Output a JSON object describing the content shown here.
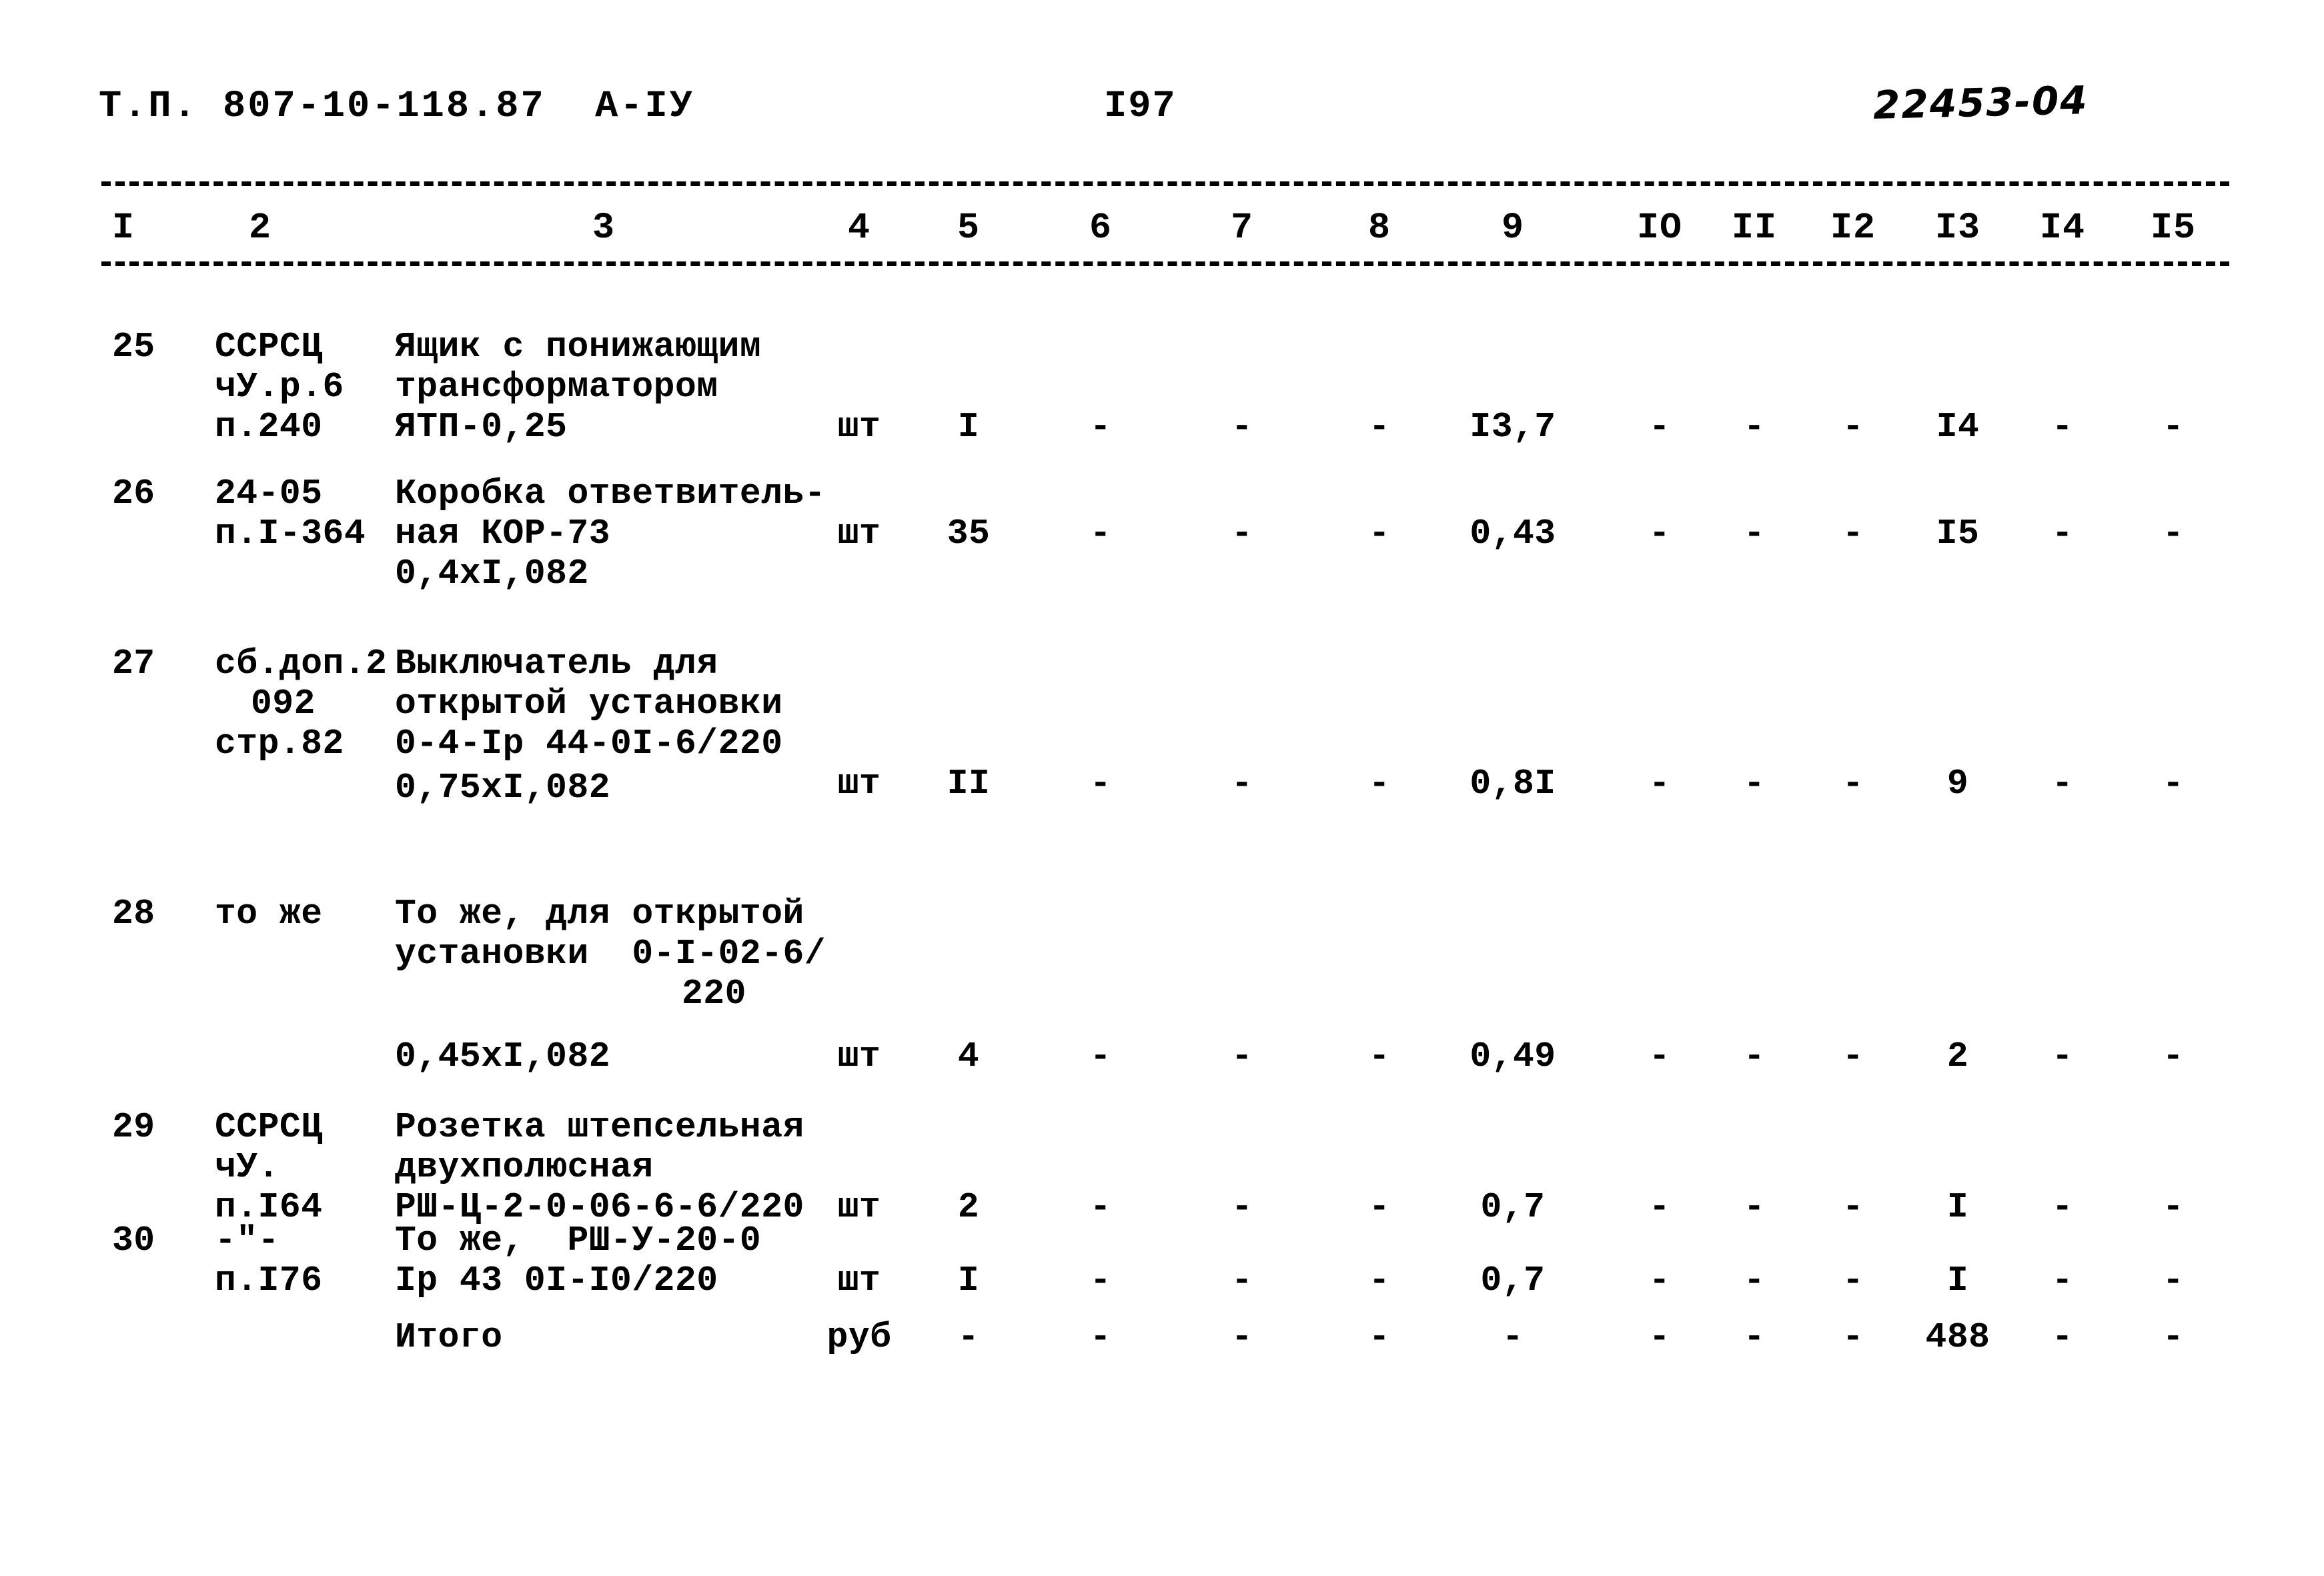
{
  "header": {
    "doc_code": "Т.П. 807-10-118.87  А-IУ",
    "page_number": "I97",
    "archive_code": "22453-04"
  },
  "table": {
    "column_numbers": [
      "I",
      "2",
      "3",
      "4",
      "5",
      "6",
      "7",
      "8",
      "9",
      "IO",
      "II",
      "I2",
      "I3",
      "I4",
      "I5"
    ],
    "rows": [
      {
        "no": "25",
        "code_lines": [
          "ССРСЦ",
          "чУ.р.6",
          "п.240"
        ],
        "name_lines": [
          "Ящик с понижающим",
          "трансформатором",
          "ЯТП-0,25"
        ],
        "unit": "шт",
        "values": [
          "I",
          "-",
          "-",
          "-",
          "I3,7",
          "-",
          "-",
          "-",
          "I4",
          "-",
          "-"
        ]
      },
      {
        "no": "26",
        "code_lines": [
          "24-05",
          "п.I-364"
        ],
        "name_lines": [
          "Коробка ответвитель-",
          "ная КОР-73",
          "0,4хI,082"
        ],
        "unit": "шт",
        "values": [
          "35",
          "-",
          "-",
          "-",
          "0,43",
          "-",
          "-",
          "-",
          "I5",
          "-",
          "-"
        ]
      },
      {
        "no": "27",
        "code_lines": [
          "сб.доп.2",
          "092",
          "стр.82"
        ],
        "name_lines": [
          "Выключатель для",
          "открытой установки",
          "0-4-Iр 44-0I-6/220",
          "0,75хI,082"
        ],
        "unit": "шт",
        "values": [
          "II",
          "-",
          "-",
          "-",
          "0,8I",
          "-",
          "-",
          "-",
          "9",
          "-",
          "-"
        ]
      },
      {
        "no": "28",
        "code_lines": [
          "то же"
        ],
        "name_lines": [
          "То же, для открытой",
          "установки  0-I-02-6/",
          "220",
          "0,45хI,082"
        ],
        "unit": "шт",
        "values": [
          "4",
          "-",
          "-",
          "-",
          "0,49",
          "-",
          "-",
          "-",
          "2",
          "-",
          "-"
        ]
      },
      {
        "no": "29",
        "code_lines": [
          "ССРСЦ",
          "чУ.",
          "п.I64"
        ],
        "name_lines": [
          "Розетка штепсельная",
          "двухполюсная",
          "РШ-Ц-2-0-06-6-6/220"
        ],
        "unit": "шт",
        "values": [
          "2",
          "-",
          "-",
          "-",
          "0,7",
          "-",
          "-",
          "-",
          "I",
          "-",
          "-"
        ]
      },
      {
        "no": "30",
        "code_lines": [
          "-\"-",
          "п.I76"
        ],
        "name_lines": [
          "То же,  РШ-У-20-0",
          "Iр 43 0I-I0/220"
        ],
        "unit": "шт",
        "values": [
          "I",
          "-",
          "-",
          "-",
          "0,7",
          "-",
          "-",
          "-",
          "I",
          "-",
          "-"
        ]
      }
    ],
    "total_row": {
      "label": "Итого",
      "unit": "руб",
      "values": [
        "-",
        "-",
        "-",
        "-",
        "-",
        "-",
        "-",
        "-",
        "488",
        "-",
        "-"
      ]
    }
  }
}
